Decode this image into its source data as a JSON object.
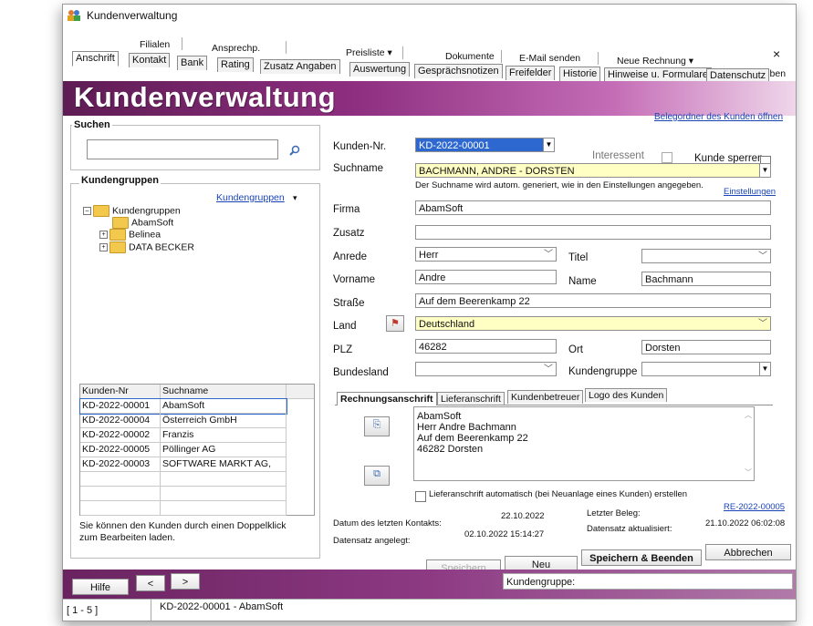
{
  "window": {
    "title": "Kundenverwaltung",
    "close_glyph": "×"
  },
  "ribbon": {
    "row1": [
      "Filialen",
      "Ansprechp.",
      "Preisliste ▾",
      "Dokumente",
      "E-Mail senden",
      "Neue Rechnung ▾",
      "Brief schreiben"
    ],
    "tabs": [
      "Anschrift",
      "Kontakt",
      "Bank",
      "Rating",
      "Zusatz Angaben",
      "Auswertung",
      "Gesprächsnotizen",
      "Freifelder",
      "Historie",
      "Hinweise u. Formulare",
      "Datenschutz"
    ]
  },
  "banner": {
    "title": "Kundenverwaltung",
    "belegordner_link": "Belegordner des Kunden öffnen"
  },
  "search": {
    "title": "Suchen",
    "value": ""
  },
  "kundengruppen": {
    "title": "Kundengruppen",
    "link": "Kundengruppen",
    "tree": [
      "Kundengruppen",
      "AbamSoft",
      "Belinea",
      "DATA BECKER"
    ]
  },
  "customer_list": {
    "headers": [
      "Kunden-Nr",
      "Suchname"
    ],
    "rows": [
      [
        "KD-2022-00001",
        "AbamSoft"
      ],
      [
        "KD-2022-00004",
        "Österreich GmbH"
      ],
      [
        "KD-2022-00002",
        "Franzis"
      ],
      [
        "KD-2022-00005",
        "Pöllinger AG"
      ],
      [
        "KD-2022-00003",
        "SOFTWARE MARKT AG,"
      ]
    ],
    "hint": "Sie können den Kunden durch einen Doppelklick zum Bearbeiten laden."
  },
  "form": {
    "kundennr_label": "Kunden-Nr.",
    "kundennr_value": "KD-2022-00001",
    "interessent_label": "Interessent",
    "kunde_sperren_label": "Kunde sperren",
    "suchname_label": "Suchname",
    "suchname_value": "BACHMANN, ANDRE - DORSTEN",
    "suchname_hint": "Der Suchname wird autom. generiert, wie in den Einstellungen angegeben.",
    "einstellungen_link": "Einstellungen",
    "firma_label": "Firma",
    "firma_value": "AbamSoft",
    "zusatz_label": "Zusatz",
    "zusatz_value": "",
    "anrede_label": "Anrede",
    "anrede_value": "Herr",
    "titel_label": "Titel",
    "titel_value": "",
    "vorname_label": "Vorname",
    "vorname_value": "Andre",
    "name_label": "Name",
    "name_value": "Bachmann",
    "strasse_label": "Straße",
    "strasse_value": "Auf dem Beerenkamp 22",
    "land_label": "Land",
    "land_value": "Deutschland",
    "plz_label": "PLZ",
    "plz_value": "46282",
    "ort_label": "Ort",
    "ort_value": "Dorsten",
    "bundesland_label": "Bundesland",
    "bundesland_value": "",
    "kundengruppe_label": "Kundengruppe",
    "kundengruppe_value": ""
  },
  "address_tabs": [
    "Rechnungsanschrift",
    "Lieferanschrift",
    "Kundenbetreuer",
    "Logo des Kunden"
  ],
  "address_block": [
    "AbamSoft",
    "Herr Andre Bachmann",
    "Auf dem Beerenkamp 22",
    "46282 Dorsten"
  ],
  "lieferanschrift_checkbox": "Lieferanschrift automatisch (bei Neuanlage eines Kunden) erstellen",
  "meta": {
    "letzter_kontakt_label": "Datum des letzten Kontakts:",
    "letzter_kontakt_value": "22.10.2022",
    "angelegt_label": "Datensatz angelegt:",
    "angelegt_value": "02.10.2022 15:14:27",
    "letzter_beleg_label": "Letzter Beleg:",
    "letzter_beleg_value": "RE-2022-00005",
    "aktualisiert_label": "Datensatz aktualisiert:",
    "aktualisiert_value": "21.10.2022 06:02:08"
  },
  "buttons": {
    "speichern": "Speichern",
    "neu": "Neu",
    "speichern_beenden": "Speichern & Beenden",
    "abbrechen": "Abbrechen",
    "hilfe": "Hilfe",
    "prev": "<",
    "next": ">"
  },
  "status": {
    "kundengruppe": "Kundengruppe:",
    "range": "[ 1 - 5 ]",
    "current": "KD-2022-00001 - AbamSoft"
  },
  "colors": {
    "accent": "#8e2f80",
    "highlight": "#ffffc4",
    "selection": "#2d67d0",
    "link": "#1a45b8"
  }
}
